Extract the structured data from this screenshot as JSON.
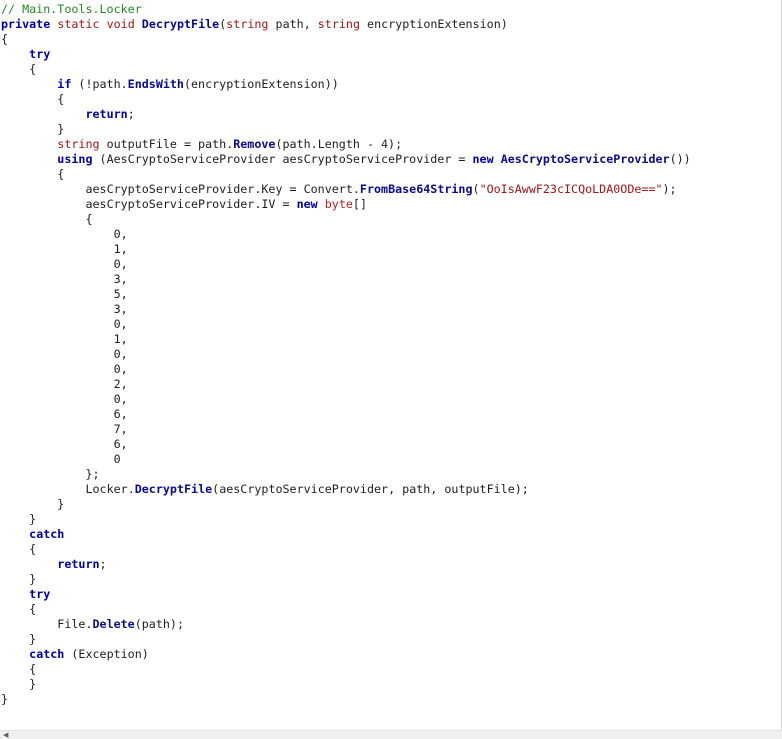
{
  "editor": {
    "comment": "// Main.Tools.Locker",
    "method_name": "DecryptFile",
    "param1_name": "path",
    "param2_name": "encryptionExtension",
    "ends_with": "EndsWith",
    "remove": "Remove",
    "aes_type": "AesCryptoServiceProvider",
    "aes_var": "aesCryptoServiceProvider",
    "convert": "Convert",
    "from_base64": "FromBase64String",
    "key_string": "\"OoIsAwwF23cICQoLDA0ODe==\"",
    "iv_values": [
      "0",
      "1",
      "0",
      "3",
      "5",
      "3",
      "0",
      "1",
      "0",
      "0",
      "2",
      "0",
      "6",
      "7",
      "6",
      "0"
    ],
    "locker_class": "Locker",
    "decrypt_call": "DecryptFile",
    "file_class": "File",
    "delete_call": "Delete",
    "exception_type": "Exception"
  },
  "theme": {
    "comment_color": "#238b23",
    "keyword_color": "#0000ff",
    "type_keyword_color": "#a31515",
    "string_color": "#a31515",
    "method_color": "#0a0a8c"
  },
  "scrollbar": {
    "left_arrow_icon": "arrow-left-icon"
  }
}
